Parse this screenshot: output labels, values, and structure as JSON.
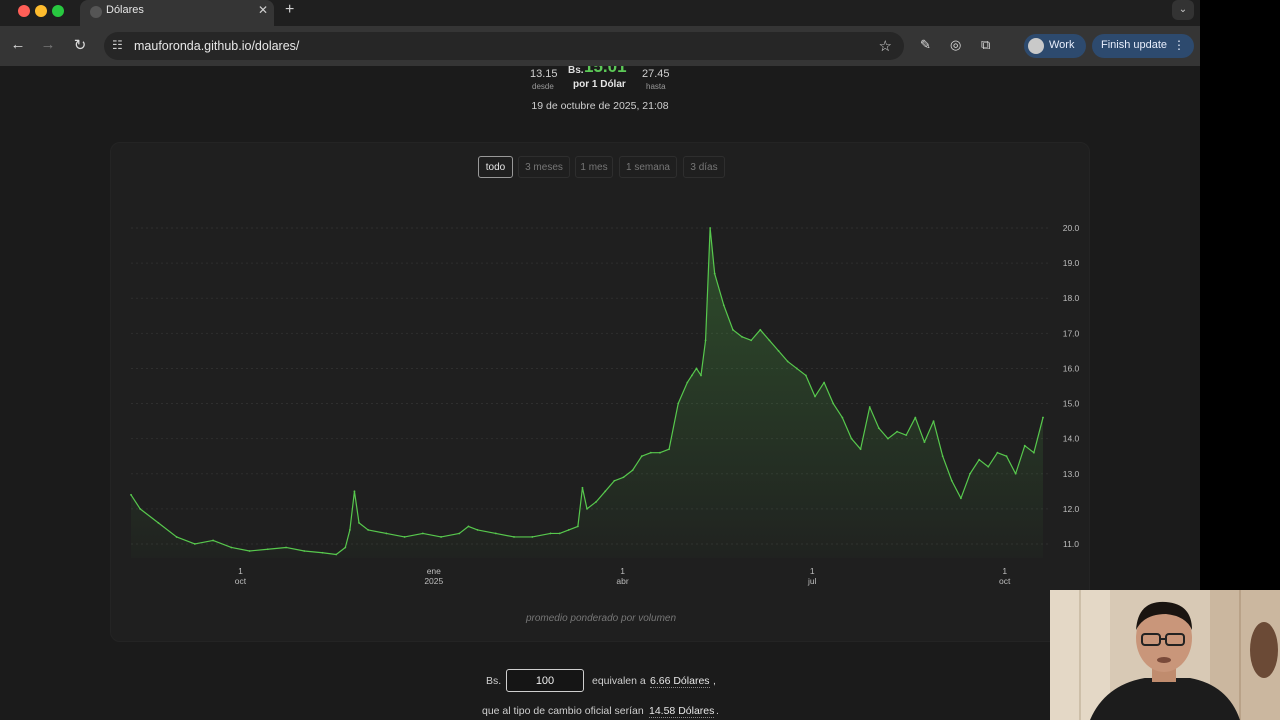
{
  "browser": {
    "tab_title": "Dólares",
    "tab_close": "✕",
    "new_tab": "+",
    "tab_menu": "⌄",
    "url": "mauforonda.github.io/dolares/",
    "profile_label": "Work",
    "update_label": "Finish update",
    "icons": [
      "back-icon",
      "forward-icon",
      "reload-icon",
      "site-info-icon",
      "star-icon",
      "extension-icon",
      "puzzle-icon"
    ]
  },
  "rate": {
    "min_value": "13.15",
    "min_label": "desde",
    "prefix": "Bs.",
    "current_value": "15.01",
    "unit_label": "por 1 Dólar",
    "max_value": "27.45",
    "max_label": "hasta",
    "date": "19 de octubre de 2025, 21:08"
  },
  "range_tabs": [
    "todo",
    "3 meses",
    "1 mes",
    "1 semana",
    "3 días"
  ],
  "chart_note": "promedio ponderado por volumen",
  "converter": {
    "prefix": "Bs.",
    "amount": "100",
    "middle_text": "equivalen a",
    "result": "6.66 Dólares",
    "tail1": ",",
    "line2": "que al tipo de cambio oficial serían",
    "official_result": "14.58 Dólares",
    "tail2": "."
  },
  "chart_data": {
    "type": "area",
    "title": "",
    "xlabel": "",
    "ylabel": "",
    "ylim": [
      10.6,
      20.2
    ],
    "y_ticks": [
      "20.0",
      "19.0",
      "18.0",
      "17.0",
      "16.0",
      "15.0",
      "14.0",
      "13.0",
      "12.0",
      "11.0"
    ],
    "x_ticks": [
      {
        "day": "1",
        "month": "oct",
        "t": 0.12
      },
      {
        "day": "ene",
        "month": "2025",
        "t": 0.332
      },
      {
        "day": "1",
        "month": "abr",
        "t": 0.539
      },
      {
        "day": "1",
        "month": "jul",
        "t": 0.747
      },
      {
        "day": "1",
        "month": "oct",
        "t": 0.958
      }
    ],
    "line_color": "#57c84d",
    "series": [
      {
        "x": [
          0,
          0.01,
          0.03,
          0.05,
          0.07,
          0.09,
          0.11,
          0.13,
          0.15,
          0.17,
          0.19,
          0.21,
          0.225,
          0.235,
          0.24,
          0.245,
          0.25,
          0.26,
          0.28,
          0.3,
          0.32,
          0.34,
          0.36,
          0.37,
          0.38,
          0.4,
          0.42,
          0.44,
          0.46,
          0.47,
          0.48,
          0.49,
          0.495,
          0.5,
          0.51,
          0.52,
          0.53,
          0.54,
          0.55,
          0.56,
          0.57,
          0.58,
          0.59,
          0.6,
          0.61,
          0.615,
          0.62,
          0.625,
          0.63,
          0.635,
          0.64,
          0.65,
          0.66,
          0.67,
          0.68,
          0.69,
          0.7,
          0.71,
          0.72,
          0.73,
          0.74,
          0.75,
          0.76,
          0.77,
          0.78,
          0.79,
          0.8,
          0.81,
          0.82,
          0.83,
          0.84,
          0.85,
          0.86,
          0.87,
          0.88,
          0.89,
          0.9,
          0.91,
          0.92,
          0.93,
          0.94,
          0.95,
          0.96,
          0.97,
          0.98,
          0.99,
          1.0
        ],
        "y": [
          12.4,
          12.0,
          11.6,
          11.2,
          11.0,
          11.1,
          10.9,
          10.8,
          10.85,
          10.9,
          10.8,
          10.75,
          10.7,
          10.9,
          11.4,
          12.5,
          11.6,
          11.4,
          11.3,
          11.2,
          11.3,
          11.2,
          11.3,
          11.5,
          11.4,
          11.3,
          11.2,
          11.2,
          11.3,
          11.3,
          11.4,
          11.5,
          12.6,
          12.0,
          12.2,
          12.5,
          12.8,
          12.9,
          13.1,
          13.5,
          13.6,
          13.6,
          13.7,
          15.0,
          15.6,
          15.8,
          16.0,
          15.8,
          16.8,
          20.0,
          18.7,
          17.8,
          17.1,
          16.9,
          16.8,
          17.1,
          16.8,
          16.5,
          16.2,
          16.0,
          15.8,
          15.2,
          15.6,
          15.0,
          14.6,
          14.0,
          13.7,
          14.9,
          14.3,
          14.0,
          14.2,
          14.1,
          14.6,
          13.9,
          14.5,
          13.5,
          12.8,
          12.3,
          13.0,
          13.4,
          13.2,
          13.6,
          13.5,
          13.0,
          13.8,
          13.6,
          14.6
        ]
      }
    ]
  }
}
